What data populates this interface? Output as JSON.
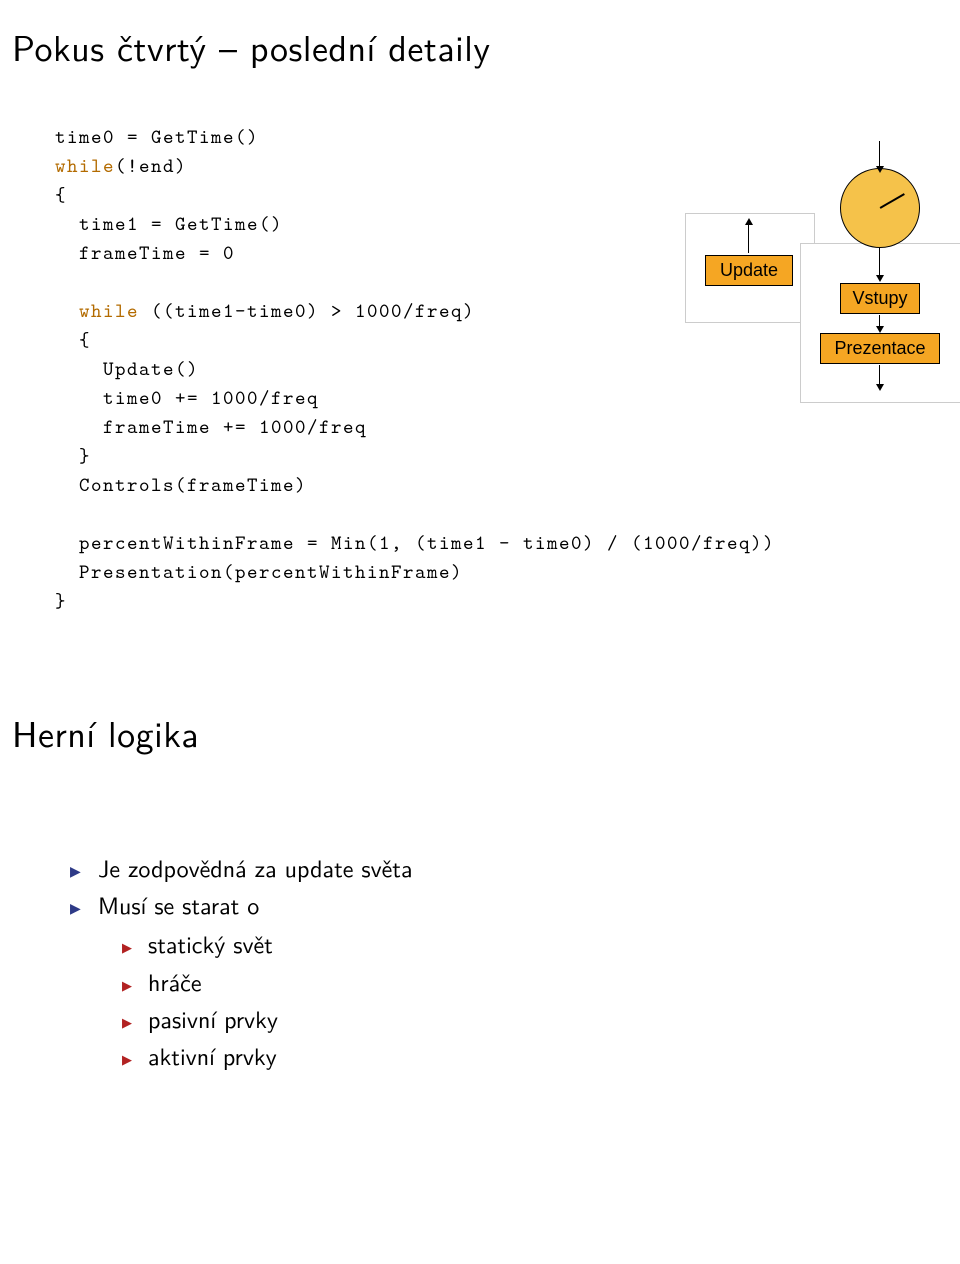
{
  "slide1": {
    "title": "Pokus čtvrtý – poslední detaily",
    "code": {
      "l1a": "time0 = GetTime()",
      "l2a": "while",
      "l2b": "(!end)",
      "l3": "{",
      "l4": "  time1 = GetTime()",
      "l5": "  frameTime = 0",
      "l6": "",
      "l7a": "  while",
      "l7b": " ((time1-time0) > 1000/freq)",
      "l8": "  {",
      "l9": "    Update()",
      "l10": "    time0 += 1000/freq",
      "l11": "    frameTime += 1000/freq",
      "l12": "  }",
      "l13": "  Controls(frameTime)",
      "l14": "",
      "l15": "  percentWithinFrame = Min(1, (time1 - time0) / (1000/freq))",
      "l16": "  Presentation(percentWithinFrame)",
      "l17": "}"
    },
    "diagram": {
      "update": "Update",
      "vstupy": "Vstupy",
      "prezentace": "Prezentace"
    }
  },
  "slide2": {
    "title": "Herní logika",
    "bullets": {
      "b1": "Je zodpovědná za update světa",
      "b2": "Musí se starat o",
      "sub": {
        "s1": "statický svět",
        "s2": "hráče",
        "s3": "pasivní prvky",
        "s4": "aktivní prvky"
      }
    }
  }
}
